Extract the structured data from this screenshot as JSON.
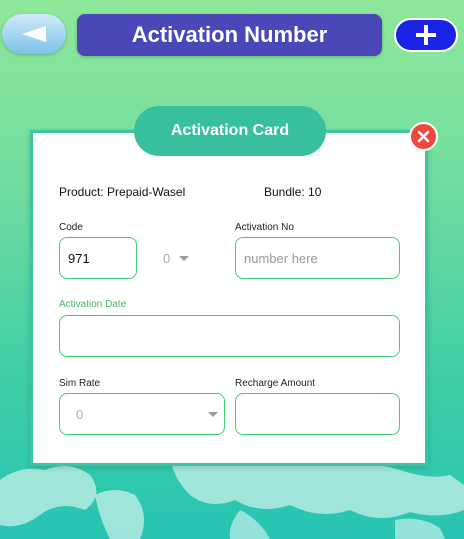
{
  "header": {
    "title": "Activation Number",
    "back_icon": "back-arrow-icon",
    "add_icon": "plus-icon"
  },
  "card": {
    "tab_label": "Activation Card",
    "close_icon": "close-icon",
    "product": "Product: Prepaid-Wasel",
    "bundle": "Bundle: 10",
    "code_label": "Code",
    "code_value": "971",
    "code_select_value": "0",
    "activation_no_label": "Activation No",
    "activation_no_placeholder": "number here",
    "activation_date_label": "Activation Date",
    "activation_date_value": "",
    "sim_rate_label": "Sim Rate",
    "sim_rate_value": "0",
    "recharge_amount_label": "Recharge Amount",
    "recharge_amount_value": ""
  },
  "colors": {
    "title_bg": "#4a48b8",
    "add_button": "#1a23e6",
    "card_accent": "#37bf9e",
    "field_border": "#3fcf6e",
    "close_button": "#f0473e"
  }
}
